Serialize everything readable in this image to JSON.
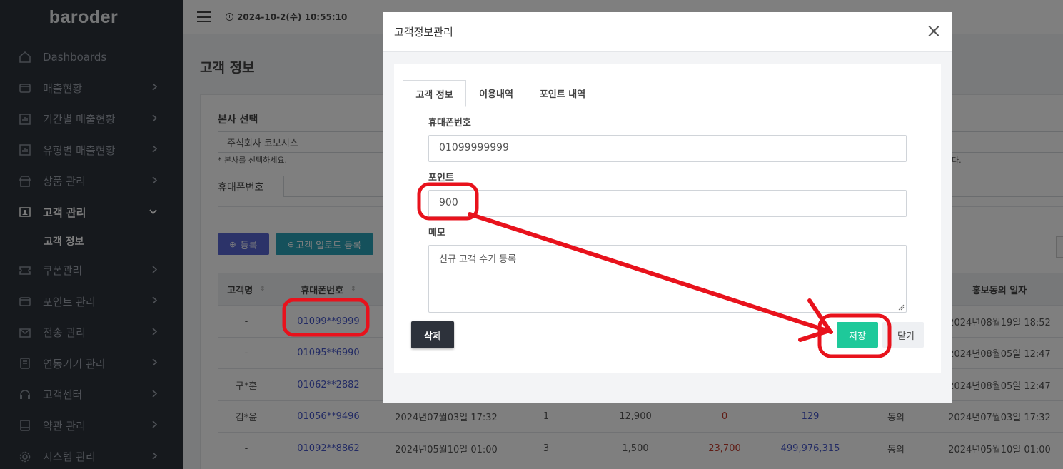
{
  "app": {
    "logo": "baroder",
    "datetime": "2024-10-2(수) 10:55:10"
  },
  "sidebar": {
    "items": [
      {
        "label": "Dashboards",
        "icon": "home-icon",
        "chev": false
      },
      {
        "label": "매출현황",
        "icon": "wallet-icon",
        "chev": true
      },
      {
        "label": "기간별 매출현황",
        "icon": "bar-chart-icon",
        "chev": true
      },
      {
        "label": "유형별 매출현황",
        "icon": "bar-chart-icon",
        "chev": true
      },
      {
        "label": "상품 관리",
        "icon": "store-icon",
        "chev": true
      },
      {
        "label": "고객 관리",
        "icon": "contact-card-icon",
        "chev": true,
        "active": true
      },
      {
        "label": "쿠폰관리",
        "icon": "ticket-icon",
        "chev": true
      },
      {
        "label": "포인트 관리",
        "icon": "wallet-icon",
        "chev": true
      },
      {
        "label": "전송 관리",
        "icon": "mail-icon",
        "chev": true
      },
      {
        "label": "연동기기 관리",
        "icon": "device-icon",
        "chev": true
      },
      {
        "label": "고객센터",
        "icon": "headset-icon",
        "chev": true
      },
      {
        "label": "약관 관리",
        "icon": "book-icon",
        "chev": true
      },
      {
        "label": "시스템 관리",
        "icon": "gear-icon",
        "chev": true
      }
    ],
    "sub_item": "고객 정보"
  },
  "page": {
    "title": "고객 정보",
    "hq_label": "본사 선택",
    "hq_value": "주식회사 코보시스",
    "hq_hint": "* 본사를 선택하세요.",
    "hint_right": "다.",
    "phone_label": "휴대폰번호",
    "register_btn": "등록",
    "upload_btn": "고객 업로드 등록"
  },
  "table": {
    "headers": [
      "고객명",
      "휴대폰번호",
      "홍보동의 일자"
    ],
    "rows": [
      {
        "name": "-",
        "phone": "01099**9999",
        "date": "",
        "count": "",
        "amount": "",
        "used": "",
        "point": "",
        "agree": "",
        "promo": "2024년08월19일 18:52"
      },
      {
        "name": "-",
        "phone": "01095**6990",
        "date": "",
        "count": "",
        "amount": "",
        "used": "",
        "point": "",
        "agree": "",
        "promo": "2024년08월05일 12:47"
      },
      {
        "name": "구*훈",
        "phone": "01062**2882",
        "date": "",
        "count": "",
        "amount": "",
        "used": "",
        "point": "",
        "agree": "",
        "promo": "2024년08월05일 12:47"
      },
      {
        "name": "김*윤",
        "phone": "01056**9496",
        "date": "2024년07월03일 17:32",
        "count": "1",
        "amount": "12,900",
        "used": "0",
        "point": "129",
        "agree": "동의",
        "promo": "2024년07월03일 17:32"
      },
      {
        "name": "-",
        "phone": "01092**8862",
        "date": "2024년05월10일 01:00",
        "count": "3",
        "amount": "1,500",
        "used": "23,700",
        "point": "499,976,315",
        "agree": "동의",
        "promo": "2024년05월10일 01:00"
      }
    ]
  },
  "modal": {
    "title": "고객정보관리",
    "tabs": [
      "고객 정보",
      "이용내역",
      "포인트 내역"
    ],
    "phone_label": "휴대폰번호",
    "phone_value": "01099999999",
    "point_label": "포인트",
    "point_value": "900",
    "memo_label": "메모",
    "memo_value": "신규 고객 수기 등록",
    "delete_btn": "삭제",
    "save_btn": "저장",
    "close_btn": "닫기"
  },
  "colors": {
    "sidebar": "#2d323b",
    "save": "#1ec99a",
    "annotation": "#e8121c",
    "register": "#5866d2",
    "upload": "#2aa3b8"
  }
}
